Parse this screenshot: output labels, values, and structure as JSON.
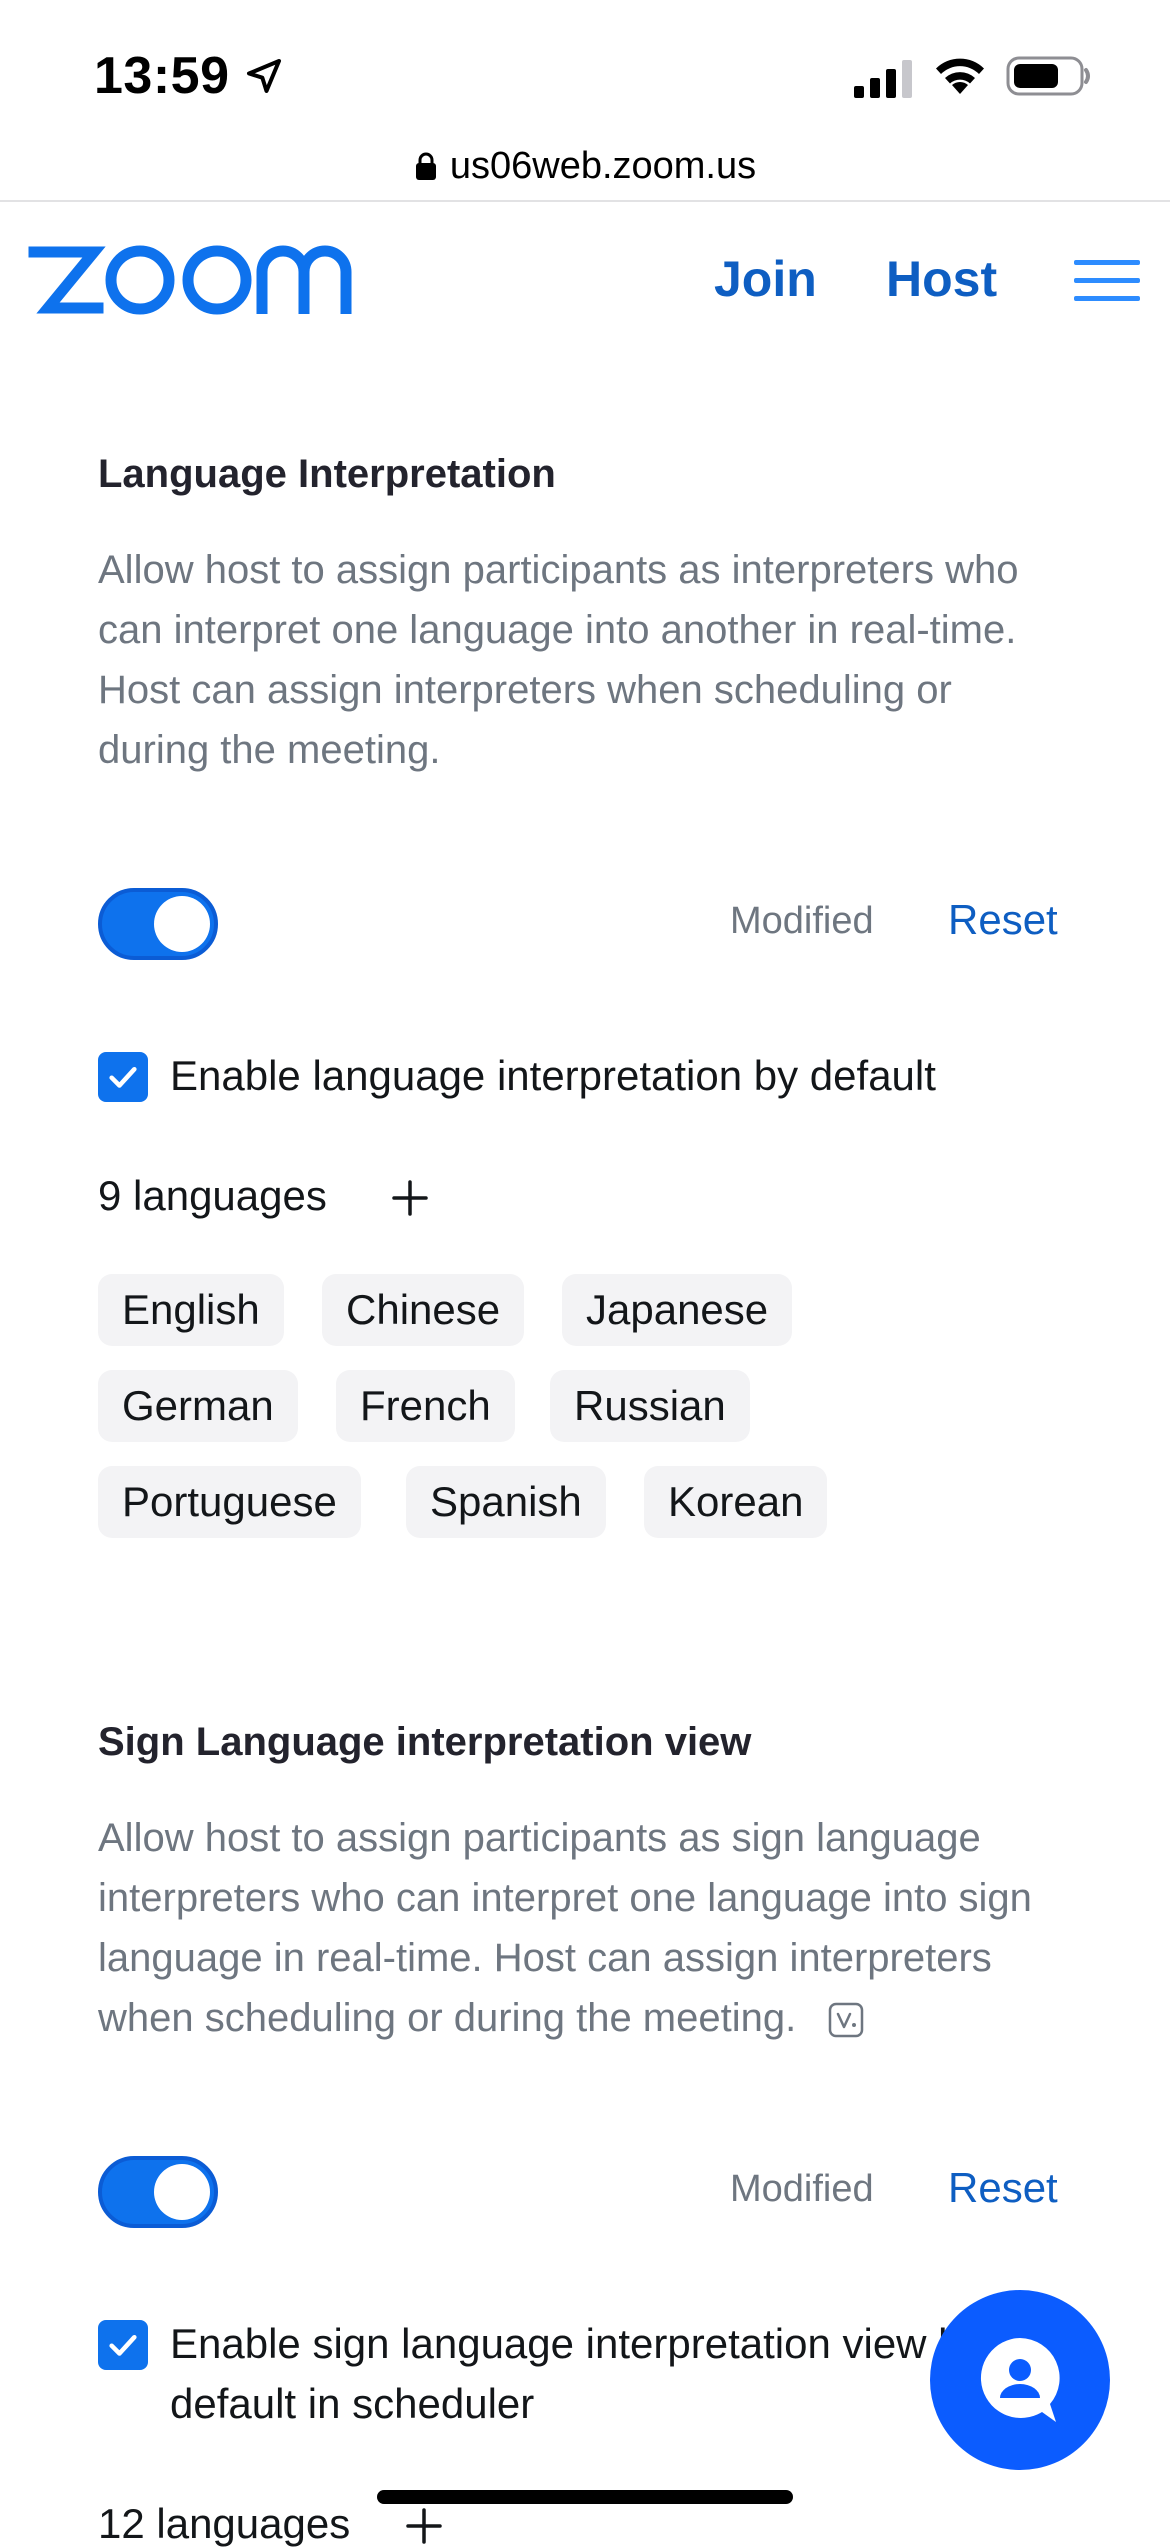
{
  "status_bar": {
    "time": "13:59",
    "icons": [
      "location-arrow-icon",
      "cellular-signal-icon",
      "wifi-icon",
      "battery-icon"
    ]
  },
  "browser": {
    "url": "us06web.zoom.us"
  },
  "header": {
    "logo_text": "zoom",
    "nav": {
      "join": "Join",
      "host": "Host"
    },
    "brand_color": "#0e72ed",
    "link_color": "#0e5ec2"
  },
  "language_interpretation": {
    "title": "Language Interpretation",
    "description": "Allow host to assign participants as interpreters who can interpret one language into another in real-time. Host can assign interpreters when scheduling or during the meeting.",
    "toggle_on": true,
    "modified_label": "Modified",
    "reset_label": "Reset",
    "checkbox_label": "Enable language interpretation by default",
    "checkbox_checked": true,
    "languages_count_label": "9 languages",
    "languages": [
      "English",
      "Chinese",
      "Japanese",
      "German",
      "French",
      "Russian",
      "Portuguese",
      "Spanish",
      "Korean"
    ]
  },
  "sign_language": {
    "title": "Sign Language interpretation view",
    "description": "Allow host to assign participants as sign language interpreters who can interpret one language into sign language in real-time. Host can assign interpreters when scheduling or during the meeting.",
    "toggle_on": true,
    "modified_label": "Modified",
    "reset_label": "Reset",
    "checkbox_label": "Enable sign language interpretation view by default in scheduler",
    "checkbox_checked": true,
    "languages_count_label": "12 languages"
  }
}
